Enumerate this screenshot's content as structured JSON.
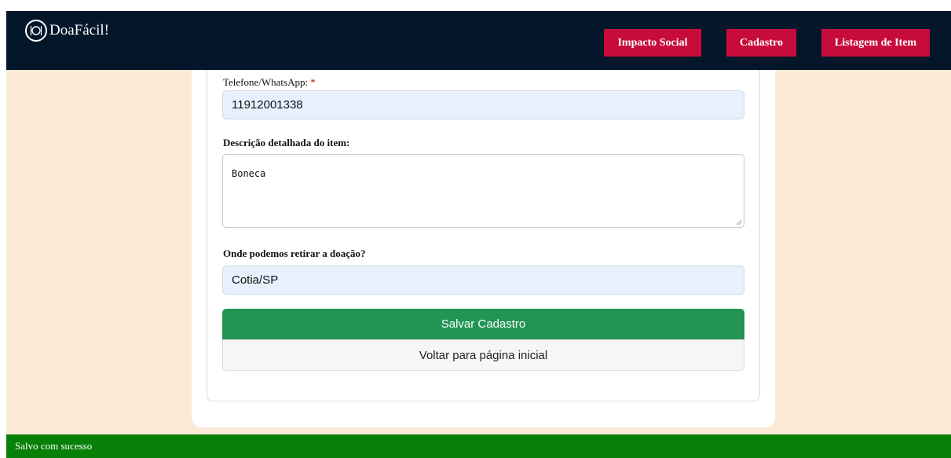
{
  "navbar": {
    "brand": "DoaFácil!",
    "brand_icon": "plate-cutlery-icon",
    "links": [
      "Impacto Social",
      "Cadastro",
      "Listagem de Item"
    ],
    "bg_color": "#04172a",
    "link_color": "#c70b3a"
  },
  "form": {
    "phone_label": "Telefone/WhatsApp:",
    "required_mark": "*",
    "phone_value": "11912001338",
    "description_label": "Descrição detalhada do item:",
    "description_value": "Boneca",
    "pickup_label": "Onde podemos retirar a doação?",
    "pickup_value": "Cotia/SP",
    "save_button": "Salvar Cadastro",
    "back_button": "Voltar para página inicial"
  },
  "toast": {
    "message": "Salvo com sucesso",
    "color": "#068006"
  }
}
